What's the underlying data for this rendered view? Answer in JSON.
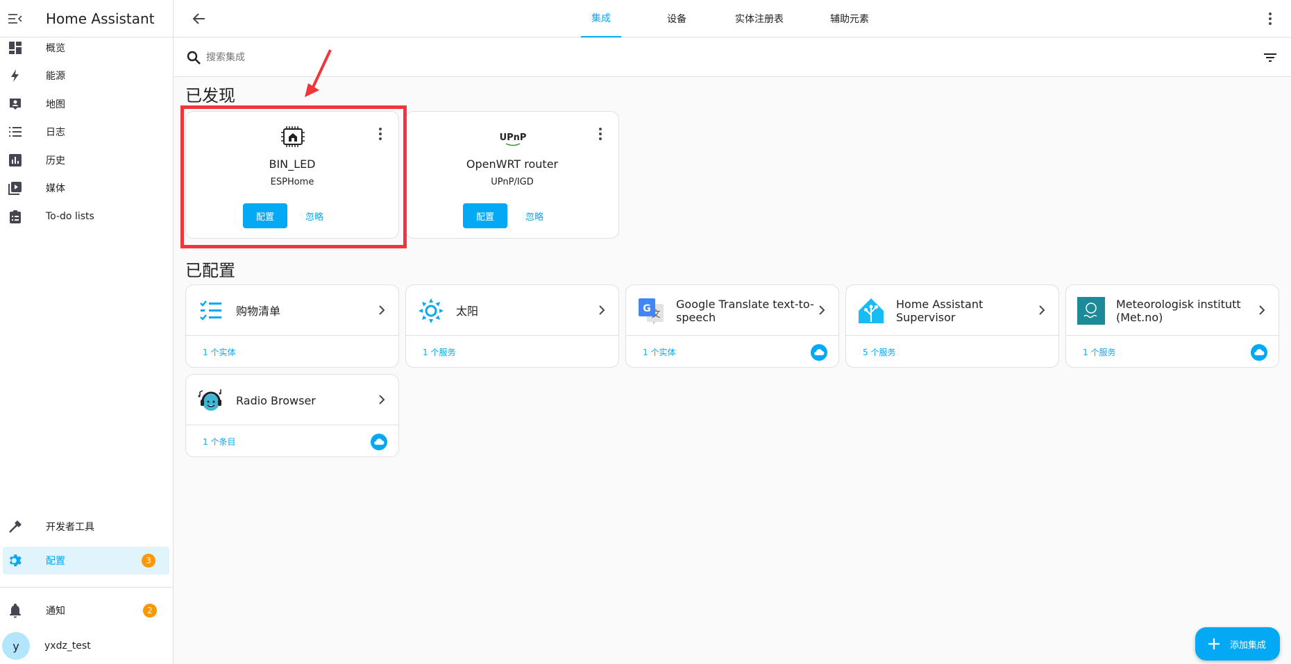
{
  "app": {
    "title": "Home Assistant"
  },
  "sidebar": {
    "items": [
      {
        "label": "概览",
        "icon": "dashboard-icon"
      },
      {
        "label": "能源",
        "icon": "lightning-icon"
      },
      {
        "label": "地图",
        "icon": "map-account-icon"
      },
      {
        "label": "日志",
        "icon": "list-icon"
      },
      {
        "label": "历史",
        "icon": "chart-box-icon"
      },
      {
        "label": "媒体",
        "icon": "play-box-icon"
      },
      {
        "label": "To-do lists",
        "icon": "clipboard-list-icon"
      }
    ],
    "dev_tools": {
      "label": "开发者工具",
      "icon": "hammer-icon"
    },
    "config": {
      "label": "配置",
      "badge": "3",
      "icon": "gear-icon"
    },
    "notifications": {
      "label": "通知",
      "badge": "2",
      "icon": "bell-icon"
    },
    "user": {
      "initial": "y",
      "name": "yxdz_test"
    }
  },
  "tabs": [
    {
      "label": "集成",
      "active": true
    },
    {
      "label": "设备",
      "active": false
    },
    {
      "label": "实体注册表",
      "active": false
    },
    {
      "label": "辅助元素",
      "active": false
    }
  ],
  "search": {
    "placeholder": "搜索集成",
    "value": ""
  },
  "sections": {
    "discovered": "已发现",
    "configured": "已配置"
  },
  "discovered": [
    {
      "name": "BIN_LED",
      "sub": "ESPHome",
      "configure": "配置",
      "ignore": "忽略",
      "icon": "esphome-chip-icon"
    },
    {
      "name": "OpenWRT router",
      "sub": "UPnP/IGD",
      "configure": "配置",
      "ignore": "忽略",
      "icon": "upnp-logo-icon",
      "logo_text": "UPnP"
    }
  ],
  "configured": [
    {
      "name": "购物清单",
      "footer": "1 个实体",
      "cloud": false,
      "icon": "shopping-list-icon"
    },
    {
      "name": "太阳",
      "footer": "1 个服务",
      "cloud": false,
      "icon": "sun-icon"
    },
    {
      "name": "Google Translate text-to-speech",
      "footer": "1 个实体",
      "cloud": true,
      "icon": "google-translate-icon"
    },
    {
      "name": "Home Assistant Supervisor",
      "footer": "5 个服务",
      "cloud": false,
      "icon": "home-assistant-icon"
    },
    {
      "name": "Meteorologisk institutt (Met.no)",
      "footer": "1 个服务",
      "cloud": true,
      "icon": "met-no-icon"
    },
    {
      "name": "Radio Browser",
      "footer": "1 个条目",
      "cloud": true,
      "icon": "radio-browser-icon"
    }
  ],
  "fab": {
    "label": "添加集成",
    "icon": "plus-icon"
  },
  "colors": {
    "accent": "#03a9f4",
    "badge": "#ff9800",
    "highlight": "#f1353a",
    "icon_gray": "#44474f"
  }
}
